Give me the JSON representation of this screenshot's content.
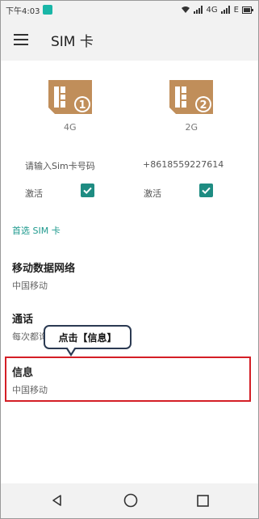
{
  "status_bar": {
    "time": "下午4:03",
    "network": "4G",
    "signal_text": "E"
  },
  "app_bar": {
    "menu_icon": "hamburger-icon",
    "title": "SIM 卡"
  },
  "sims": [
    {
      "slot": "1",
      "type": "4G",
      "number": "请输入Sim卡号码",
      "active_label": "激活",
      "active": true
    },
    {
      "slot": "2",
      "type": "2G",
      "number": "+8618559227614",
      "active_label": "激活",
      "active": true
    }
  ],
  "preferred_section": {
    "header": "首选 SIM 卡",
    "items": [
      {
        "title": "移动数据网络",
        "subtitle": "中国移动"
      },
      {
        "title": "通话",
        "subtitle": "每次都询问"
      },
      {
        "title": "信息",
        "subtitle": "中国移动"
      }
    ]
  },
  "callout": {
    "text": "点击【信息】"
  },
  "colors": {
    "accent": "#1f9a8e",
    "checkbox": "#1e8c82",
    "sim_icon": "#c08e5a",
    "highlight": "#d41f26",
    "callout_border": "#2b3a52"
  },
  "nav_bar": {
    "back_icon": "back-triangle-icon",
    "home_icon": "home-circle-icon",
    "recent_icon": "recent-square-icon"
  }
}
